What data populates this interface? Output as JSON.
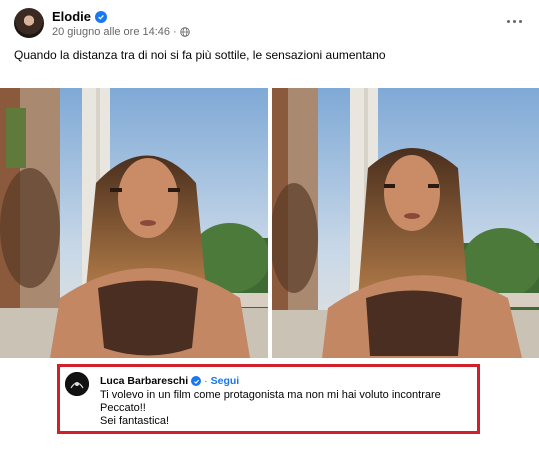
{
  "post": {
    "author": "Elodie",
    "date": "20 giugno alle ore 14:46",
    "caption": "Quando la distanza tra di noi si fa più sottile, le sensazioni aumentano",
    "author_verified_icon": "verified-badge-icon",
    "privacy_icon": "globe-icon",
    "more_icon": "more-options-icon"
  },
  "photos": [
    {
      "description_icon": "photo"
    },
    {
      "description_icon": "photo"
    }
  ],
  "comment": {
    "author": "Luca Barbareschi",
    "separator": "·",
    "follow_label": "Segui",
    "lines": [
      "Ti volevo in un film come protagonista ma non mi hai voluto incontrare",
      "Peccato!!",
      "Sei fantastica!"
    ],
    "highlight_color": "#d0202a"
  },
  "colors": {
    "accent": "#1877f2",
    "secondary_text": "#65676b"
  }
}
